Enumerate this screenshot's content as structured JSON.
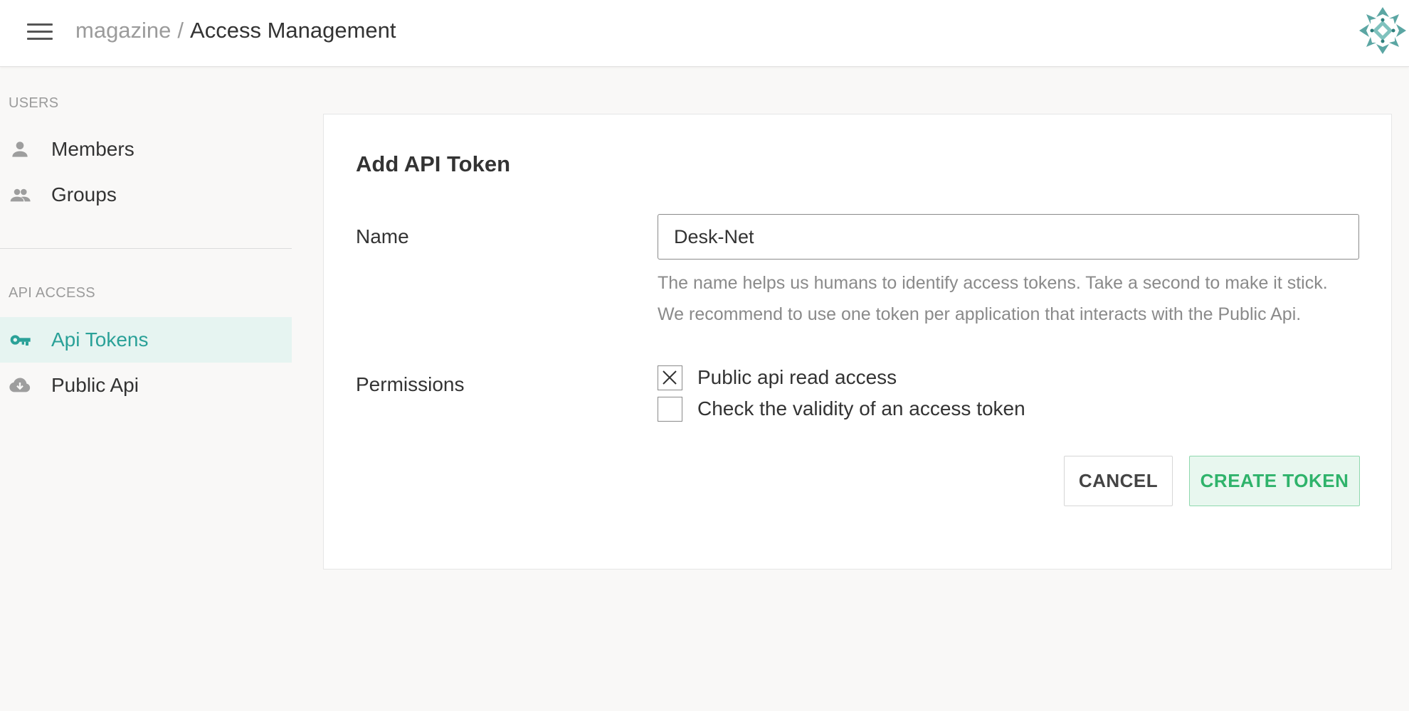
{
  "header": {
    "menu_icon": "hamburger-menu-icon",
    "breadcrumb_parent": "magazine",
    "breadcrumb_separator": "/",
    "breadcrumb_current": "Access Management",
    "avatar_icon": "geometric-pattern-avatar"
  },
  "sidebar": {
    "sections": [
      {
        "label": "USERS",
        "items": [
          {
            "label": "Members",
            "icon": "person-icon",
            "active": false
          },
          {
            "label": "Groups",
            "icon": "group-icon",
            "active": false
          }
        ]
      },
      {
        "label": "API ACCESS",
        "items": [
          {
            "label": "Api Tokens",
            "icon": "key-icon",
            "active": true
          },
          {
            "label": "Public Api",
            "icon": "cloud-icon",
            "active": false
          }
        ]
      }
    ]
  },
  "form": {
    "title": "Add API Token",
    "name_label": "Name",
    "name_value": "Desk-Net",
    "help_line_1": "The name helps us humans to identify access tokens. Take a second to make it stick.",
    "help_line_2": "We recommend to use one token per application that interacts with the Public Api.",
    "permissions_label": "Permissions",
    "permissions": [
      {
        "label": "Public api read access",
        "checked": true
      },
      {
        "label": "Check the validity of an access token",
        "checked": false
      }
    ],
    "cancel_label": "CANCEL",
    "create_label": "CREATE TOKEN"
  },
  "colors": {
    "accent_teal": "#2aa198",
    "active_bg": "#e6f4f1",
    "create_green": "#2fb36b",
    "create_bg": "#e8f7ef"
  }
}
